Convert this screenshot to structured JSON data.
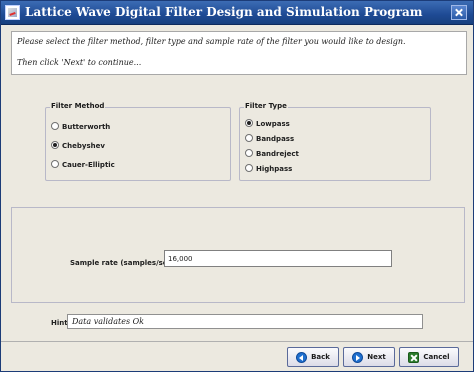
{
  "window": {
    "title": "Lattice Wave Digital Filter Design and Simulation Program"
  },
  "instructions": {
    "line1": "Please select the filter method, filter type and sample rate of the filter you would like to design.",
    "line2": "Then click 'Next' to continue..."
  },
  "filter_method": {
    "legend": "Filter Method",
    "options": [
      {
        "label": "Butterworth",
        "selected": false
      },
      {
        "label": "Chebyshev",
        "selected": true
      },
      {
        "label": "Cauer-Elliptic",
        "selected": false
      }
    ]
  },
  "filter_type": {
    "legend": "Filter Type",
    "options": [
      {
        "label": "Lowpass",
        "selected": true
      },
      {
        "label": "Bandpass",
        "selected": false
      },
      {
        "label": "Bandreject",
        "selected": false
      },
      {
        "label": "Highpass",
        "selected": false
      }
    ]
  },
  "sample_rate": {
    "label": "Sample rate (samples/sec):",
    "value": "16,000"
  },
  "hint": {
    "label": "Hint:",
    "text": "Data validates Ok"
  },
  "buttons": {
    "back": "Back",
    "next": "Next",
    "cancel": "Cancel"
  }
}
